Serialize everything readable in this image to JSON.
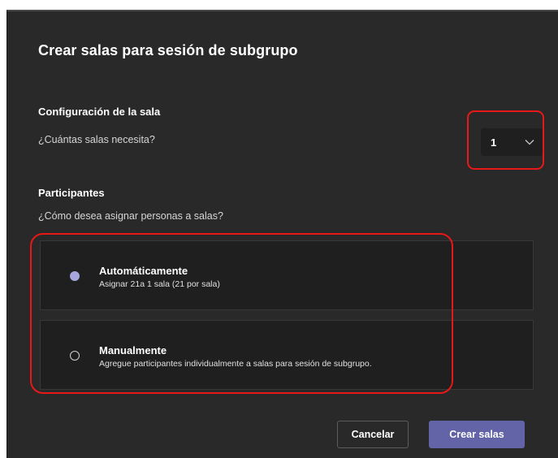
{
  "dialog": {
    "title": "Crear salas para sesión de subgrupo"
  },
  "room_config": {
    "heading": "Configuración de la sala",
    "question": "¿Cuántas salas necesita?",
    "room_count": "1"
  },
  "participants": {
    "heading": "Participantes",
    "question": "¿Cómo desea asignar personas a salas?",
    "options": [
      {
        "title": "Automáticamente",
        "description": "Asignar 21a 1 sala (21 por sala)",
        "selected": true
      },
      {
        "title": "Manualmente",
        "description": "Agregue participantes individualmente a salas para sesión de subgrupo.",
        "selected": false
      }
    ]
  },
  "footer": {
    "cancel_label": "Cancelar",
    "create_label": "Crear salas"
  },
  "colors": {
    "dialog_bg": "#292929",
    "option_bg": "#1f1f1f",
    "accent": "#6264a7",
    "radio_selected": "#a6a7dc",
    "highlight": "#e81818"
  }
}
